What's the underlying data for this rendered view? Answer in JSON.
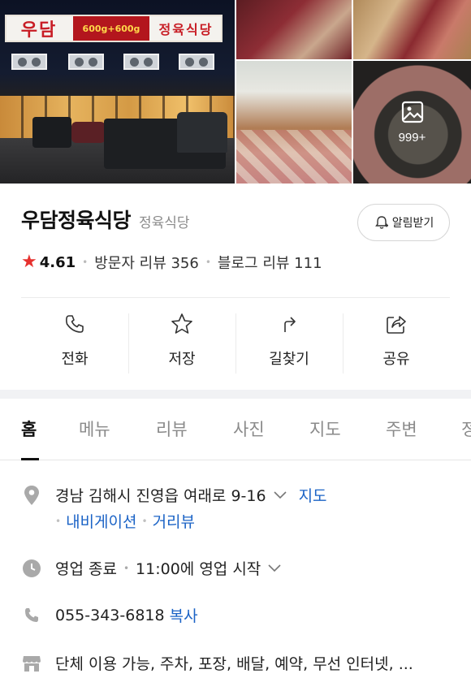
{
  "photos": {
    "main_sign_left": "우담",
    "main_sign_mid": "600g+600g",
    "main_sign_right": "정육식당",
    "more_count": "999+"
  },
  "place": {
    "name": "우담정육식당",
    "category": "정육식당",
    "alert_button": "알림받기",
    "rating": "4.61",
    "visitor_reviews": "방문자 리뷰 356",
    "blog_reviews": "블로그 리뷰 111"
  },
  "actions": [
    {
      "label": "전화",
      "icon": "phone-icon"
    },
    {
      "label": "저장",
      "icon": "star-outline-icon"
    },
    {
      "label": "길찾기",
      "icon": "directions-icon"
    },
    {
      "label": "공유",
      "icon": "share-icon"
    }
  ],
  "tabs": [
    "홈",
    "메뉴",
    "리뷰",
    "사진",
    "지도",
    "주변",
    "정"
  ],
  "active_tab": "홈",
  "info": {
    "address": "경남 김해시 진영읍 여래로 9-16",
    "address_map_link": "지도",
    "navigation_link": "내비게이션",
    "streetview_link": "거리뷰",
    "hours_status": "영업 종료",
    "hours_detail": "11:00에 영업 시작",
    "phone": "055-343-6818",
    "copy_link": "복사",
    "amenities": "단체 이용 가능, 주차, 포장, 배달, 예약, 무선 인터넷, ..."
  },
  "colors": {
    "accent_link": "#1b63c6",
    "star": "#e6312e",
    "divider": "#f1f2f4"
  }
}
